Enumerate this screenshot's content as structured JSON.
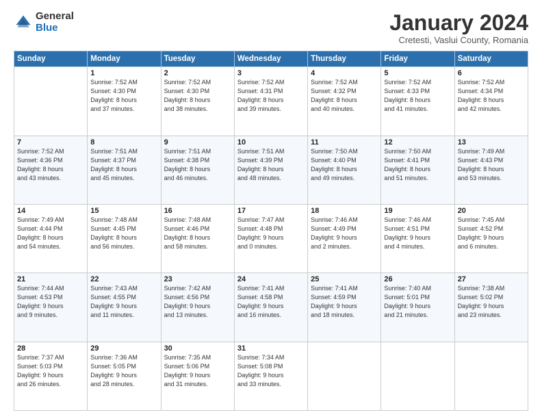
{
  "logo": {
    "general": "General",
    "blue": "Blue"
  },
  "title": "January 2024",
  "subtitle": "Cretesti, Vaslui County, Romania",
  "days_header": [
    "Sunday",
    "Monday",
    "Tuesday",
    "Wednesday",
    "Thursday",
    "Friday",
    "Saturday"
  ],
  "weeks": [
    [
      {
        "day": "",
        "sunrise": "",
        "sunset": "",
        "daylight": ""
      },
      {
        "day": "1",
        "sunrise": "Sunrise: 7:52 AM",
        "sunset": "Sunset: 4:30 PM",
        "daylight": "Daylight: 8 hours and 37 minutes."
      },
      {
        "day": "2",
        "sunrise": "Sunrise: 7:52 AM",
        "sunset": "Sunset: 4:30 PM",
        "daylight": "Daylight: 8 hours and 38 minutes."
      },
      {
        "day": "3",
        "sunrise": "Sunrise: 7:52 AM",
        "sunset": "Sunset: 4:31 PM",
        "daylight": "Daylight: 8 hours and 39 minutes."
      },
      {
        "day": "4",
        "sunrise": "Sunrise: 7:52 AM",
        "sunset": "Sunset: 4:32 PM",
        "daylight": "Daylight: 8 hours and 40 minutes."
      },
      {
        "day": "5",
        "sunrise": "Sunrise: 7:52 AM",
        "sunset": "Sunset: 4:33 PM",
        "daylight": "Daylight: 8 hours and 41 minutes."
      },
      {
        "day": "6",
        "sunrise": "Sunrise: 7:52 AM",
        "sunset": "Sunset: 4:34 PM",
        "daylight": "Daylight: 8 hours and 42 minutes."
      }
    ],
    [
      {
        "day": "7",
        "sunrise": "Sunrise: 7:52 AM",
        "sunset": "Sunset: 4:36 PM",
        "daylight": "Daylight: 8 hours and 43 minutes."
      },
      {
        "day": "8",
        "sunrise": "Sunrise: 7:51 AM",
        "sunset": "Sunset: 4:37 PM",
        "daylight": "Daylight: 8 hours and 45 minutes."
      },
      {
        "day": "9",
        "sunrise": "Sunrise: 7:51 AM",
        "sunset": "Sunset: 4:38 PM",
        "daylight": "Daylight: 8 hours and 46 minutes."
      },
      {
        "day": "10",
        "sunrise": "Sunrise: 7:51 AM",
        "sunset": "Sunset: 4:39 PM",
        "daylight": "Daylight: 8 hours and 48 minutes."
      },
      {
        "day": "11",
        "sunrise": "Sunrise: 7:50 AM",
        "sunset": "Sunset: 4:40 PM",
        "daylight": "Daylight: 8 hours and 49 minutes."
      },
      {
        "day": "12",
        "sunrise": "Sunrise: 7:50 AM",
        "sunset": "Sunset: 4:41 PM",
        "daylight": "Daylight: 8 hours and 51 minutes."
      },
      {
        "day": "13",
        "sunrise": "Sunrise: 7:49 AM",
        "sunset": "Sunset: 4:43 PM",
        "daylight": "Daylight: 8 hours and 53 minutes."
      }
    ],
    [
      {
        "day": "14",
        "sunrise": "Sunrise: 7:49 AM",
        "sunset": "Sunset: 4:44 PM",
        "daylight": "Daylight: 8 hours and 54 minutes."
      },
      {
        "day": "15",
        "sunrise": "Sunrise: 7:48 AM",
        "sunset": "Sunset: 4:45 PM",
        "daylight": "Daylight: 8 hours and 56 minutes."
      },
      {
        "day": "16",
        "sunrise": "Sunrise: 7:48 AM",
        "sunset": "Sunset: 4:46 PM",
        "daylight": "Daylight: 8 hours and 58 minutes."
      },
      {
        "day": "17",
        "sunrise": "Sunrise: 7:47 AM",
        "sunset": "Sunset: 4:48 PM",
        "daylight": "Daylight: 9 hours and 0 minutes."
      },
      {
        "day": "18",
        "sunrise": "Sunrise: 7:46 AM",
        "sunset": "Sunset: 4:49 PM",
        "daylight": "Daylight: 9 hours and 2 minutes."
      },
      {
        "day": "19",
        "sunrise": "Sunrise: 7:46 AM",
        "sunset": "Sunset: 4:51 PM",
        "daylight": "Daylight: 9 hours and 4 minutes."
      },
      {
        "day": "20",
        "sunrise": "Sunrise: 7:45 AM",
        "sunset": "Sunset: 4:52 PM",
        "daylight": "Daylight: 9 hours and 6 minutes."
      }
    ],
    [
      {
        "day": "21",
        "sunrise": "Sunrise: 7:44 AM",
        "sunset": "Sunset: 4:53 PM",
        "daylight": "Daylight: 9 hours and 9 minutes."
      },
      {
        "day": "22",
        "sunrise": "Sunrise: 7:43 AM",
        "sunset": "Sunset: 4:55 PM",
        "daylight": "Daylight: 9 hours and 11 minutes."
      },
      {
        "day": "23",
        "sunrise": "Sunrise: 7:42 AM",
        "sunset": "Sunset: 4:56 PM",
        "daylight": "Daylight: 9 hours and 13 minutes."
      },
      {
        "day": "24",
        "sunrise": "Sunrise: 7:41 AM",
        "sunset": "Sunset: 4:58 PM",
        "daylight": "Daylight: 9 hours and 16 minutes."
      },
      {
        "day": "25",
        "sunrise": "Sunrise: 7:41 AM",
        "sunset": "Sunset: 4:59 PM",
        "daylight": "Daylight: 9 hours and 18 minutes."
      },
      {
        "day": "26",
        "sunrise": "Sunrise: 7:40 AM",
        "sunset": "Sunset: 5:01 PM",
        "daylight": "Daylight: 9 hours and 21 minutes."
      },
      {
        "day": "27",
        "sunrise": "Sunrise: 7:38 AM",
        "sunset": "Sunset: 5:02 PM",
        "daylight": "Daylight: 9 hours and 23 minutes."
      }
    ],
    [
      {
        "day": "28",
        "sunrise": "Sunrise: 7:37 AM",
        "sunset": "Sunset: 5:03 PM",
        "daylight": "Daylight: 9 hours and 26 minutes."
      },
      {
        "day": "29",
        "sunrise": "Sunrise: 7:36 AM",
        "sunset": "Sunset: 5:05 PM",
        "daylight": "Daylight: 9 hours and 28 minutes."
      },
      {
        "day": "30",
        "sunrise": "Sunrise: 7:35 AM",
        "sunset": "Sunset: 5:06 PM",
        "daylight": "Daylight: 9 hours and 31 minutes."
      },
      {
        "day": "31",
        "sunrise": "Sunrise: 7:34 AM",
        "sunset": "Sunset: 5:08 PM",
        "daylight": "Daylight: 9 hours and 33 minutes."
      },
      {
        "day": "",
        "sunrise": "",
        "sunset": "",
        "daylight": ""
      },
      {
        "day": "",
        "sunrise": "",
        "sunset": "",
        "daylight": ""
      },
      {
        "day": "",
        "sunrise": "",
        "sunset": "",
        "daylight": ""
      }
    ]
  ]
}
